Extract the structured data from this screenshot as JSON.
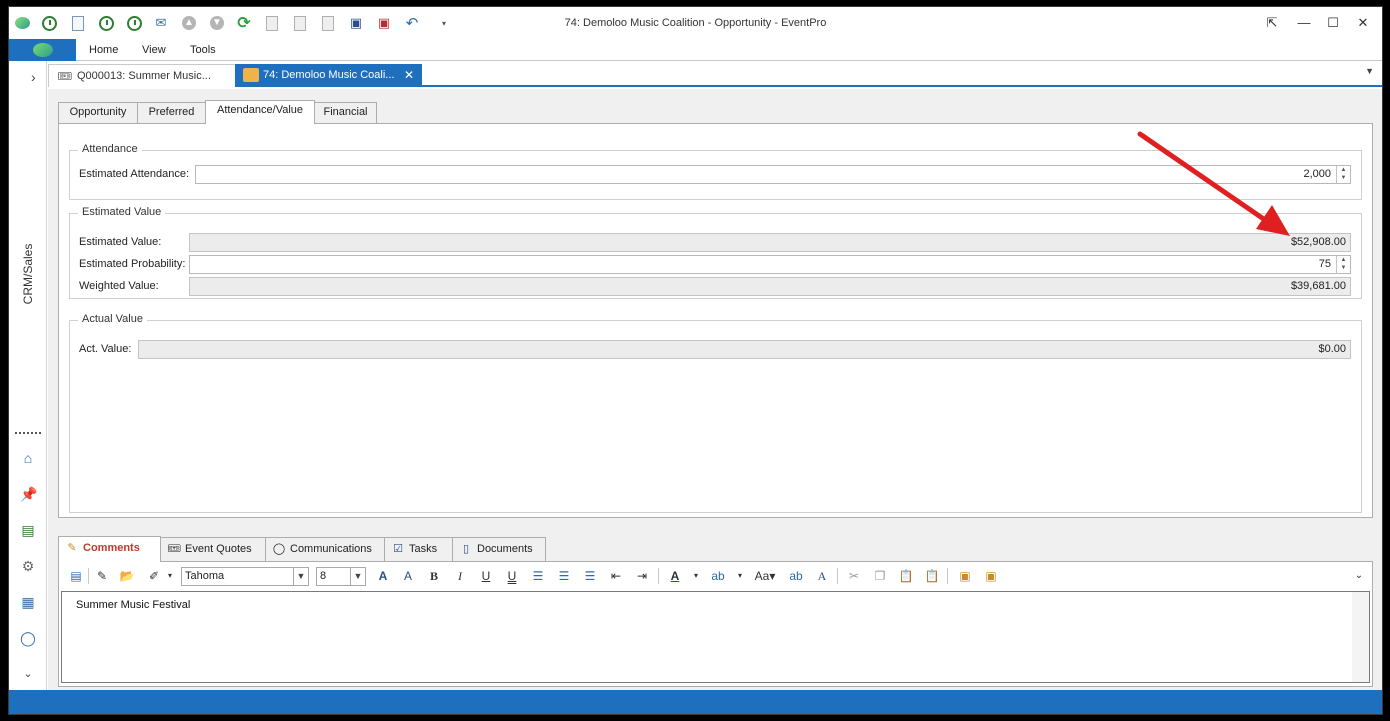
{
  "window": {
    "title": "74: Demoloo Music Coalition - Opportunity - EventPro"
  },
  "ribbon": {
    "tabs": [
      "Home",
      "View",
      "Tools"
    ]
  },
  "left_nav": {
    "label": "CRM/Sales"
  },
  "doc_tabs": [
    {
      "label": "Q000013: Summer Music..."
    },
    {
      "label": "74: Demoloo Music Coali..."
    }
  ],
  "inner_tabs": [
    "Opportunity",
    "Preferred",
    "Attendance/Value",
    "Financial"
  ],
  "attendance": {
    "legend": "Attendance",
    "estimated_attendance_label": "Estimated Attendance:",
    "estimated_attendance_value": "2,000"
  },
  "estimated_value": {
    "legend": "Estimated Value",
    "value_label": "Estimated Value:",
    "value": "$52,908.00",
    "probability_label": "Estimated Probability:",
    "probability": "75",
    "weighted_label": "Weighted Value:",
    "weighted": "$39,681.00"
  },
  "actual_value": {
    "legend": "Actual Value",
    "label": "Act. Value:",
    "value": "$0.00"
  },
  "bottom_tabs": [
    "Comments",
    "Event Quotes",
    "Communications",
    "Tasks",
    "Documents"
  ],
  "editor": {
    "font": "Tahoma",
    "size": "8",
    "text": "Summer Music Festival"
  },
  "colors": {
    "accent": "#1f6fbf",
    "annotation_arrow": "#e02020"
  }
}
